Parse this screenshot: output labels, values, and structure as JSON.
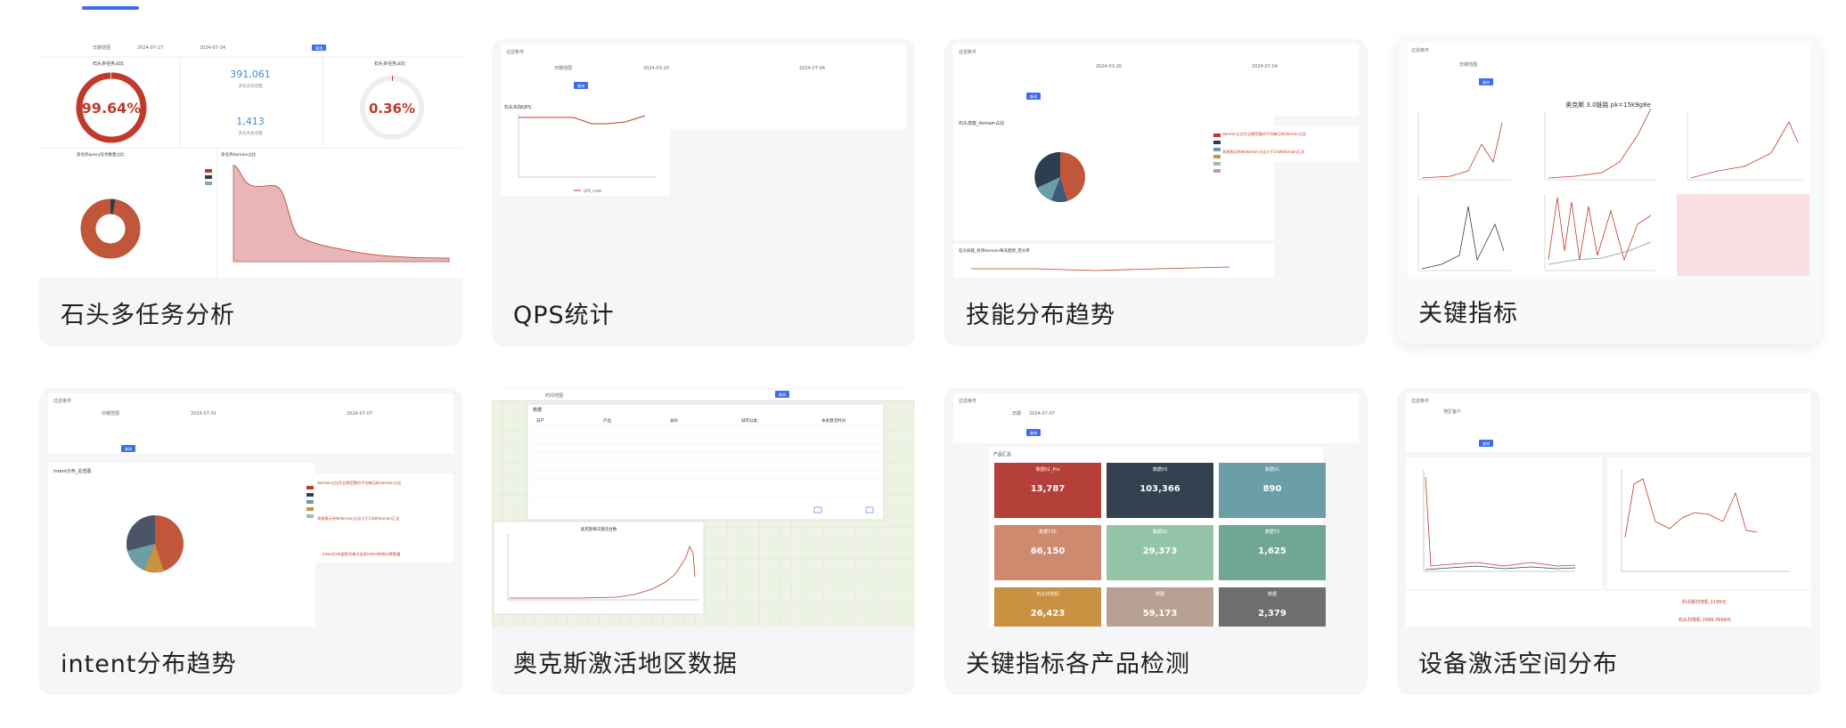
{
  "cards": [
    {
      "title": "石头多任务分析",
      "panel": {
        "date_label": "日期范围",
        "date_from": "2024-07-17",
        "date_to": "2024-07-24",
        "query_button": "查询",
        "gauge1": {
          "title": "石头多任务占比",
          "value": "99.64%"
        },
        "metric1": {
          "value": "391,061",
          "label": "多任务对话量"
        },
        "metric2": {
          "value": "1,413",
          "label": "多任务会话量"
        },
        "gauge2": {
          "title": "石头多任务占比",
          "value": "0.36%"
        },
        "donut_title": "多任务query任务数量占比",
        "area_title": "多任务domain占比"
      }
    },
    {
      "title": "QPS统计",
      "panel": {
        "header": "过滤条件",
        "date_label": "日期范围",
        "date_from": "2024-03-20",
        "date_to": "2024-07-04",
        "query_button": "查询",
        "chart_title": "石头实际QPS",
        "legend": "QPS_order"
      }
    },
    {
      "title": "技能分布趋势",
      "panel": {
        "header": "过滤条件",
        "date_from": "2024-03-20",
        "date_to": "2024-07-04",
        "query_button": "查询",
        "chart_title": "石头技能_domain占比",
        "note1": "domain占比为日期范围内平均每日的domain占比",
        "note2": "其他表示所有domain占比小于1%的domain汇总",
        "trend_title": "石头技能_各项domain每天趋势_百分率"
      }
    },
    {
      "title": "关键指标",
      "panel": {
        "header": "过滤条件",
        "date_label": "日期范围",
        "query_button": "查询",
        "chart_title": "奥克斯 3.0链路 pk=15k9g8e"
      }
    },
    {
      "title": "intent分布趋势",
      "panel": {
        "header": "过滤条件",
        "date_label": "日期范围",
        "date_from": "2024-07-01",
        "date_to": "2024-07-07",
        "query_button": "查询",
        "chart_title": "intent分布_总览图",
        "note1": "domain占比为日期范围内平均每日的domain占比",
        "note2": "其他表示所有domain占比小于1%的domain汇总",
        "note3": "intent分布趋势为每天该条intent的统计数数量"
      }
    },
    {
      "title": "奥克斯激活地区数据",
      "panel": {
        "date_label": "时间范围",
        "query_button": "查询",
        "table_title": "数据",
        "columns": [
          "日产",
          "产品",
          "省份",
          "城市分类",
          "本省激活时间"
        ],
        "chart_title": "奥克斯每日激活台数"
      }
    },
    {
      "title": "关键指标各产品检测",
      "panel": {
        "header": "过滤条件",
        "date_label": "日期",
        "date_value": "2024-07-07",
        "query_button": "查询",
        "section_title": "产品汇总",
        "tiles": [
          {
            "name": "数据01_Pro",
            "value": "13,787",
            "color": "#b5403a"
          },
          {
            "name": "数据03",
            "value": "103,366",
            "color": "#344150"
          },
          {
            "name": "数据01",
            "value": "890",
            "color": "#6c9ea8"
          },
          {
            "name": "数据T30",
            "value": "66,150",
            "color": "#ce8a6e"
          },
          {
            "name": "数据S5",
            "value": "29,373",
            "color": "#93c4a8"
          },
          {
            "name": "数据T3",
            "value": "1,625",
            "color": "#6fa695"
          },
          {
            "name": "石头扫地机",
            "value": "26,423",
            "color": "#c99142"
          },
          {
            "name": "数据",
            "value": "59,173",
            "color": "#b8a093"
          },
          {
            "name": "数据",
            "value": "2,379",
            "color": "#6e6e6e"
          }
        ]
      }
    },
    {
      "title": "设备激活空间分布",
      "panel": {
        "header": "过滤条件",
        "field_label": "地区客户",
        "query_button": "查询",
        "note1": "科沃斯扫地机 2199元",
        "note2": "石头扫地机 2999-3999元"
      }
    }
  ]
}
